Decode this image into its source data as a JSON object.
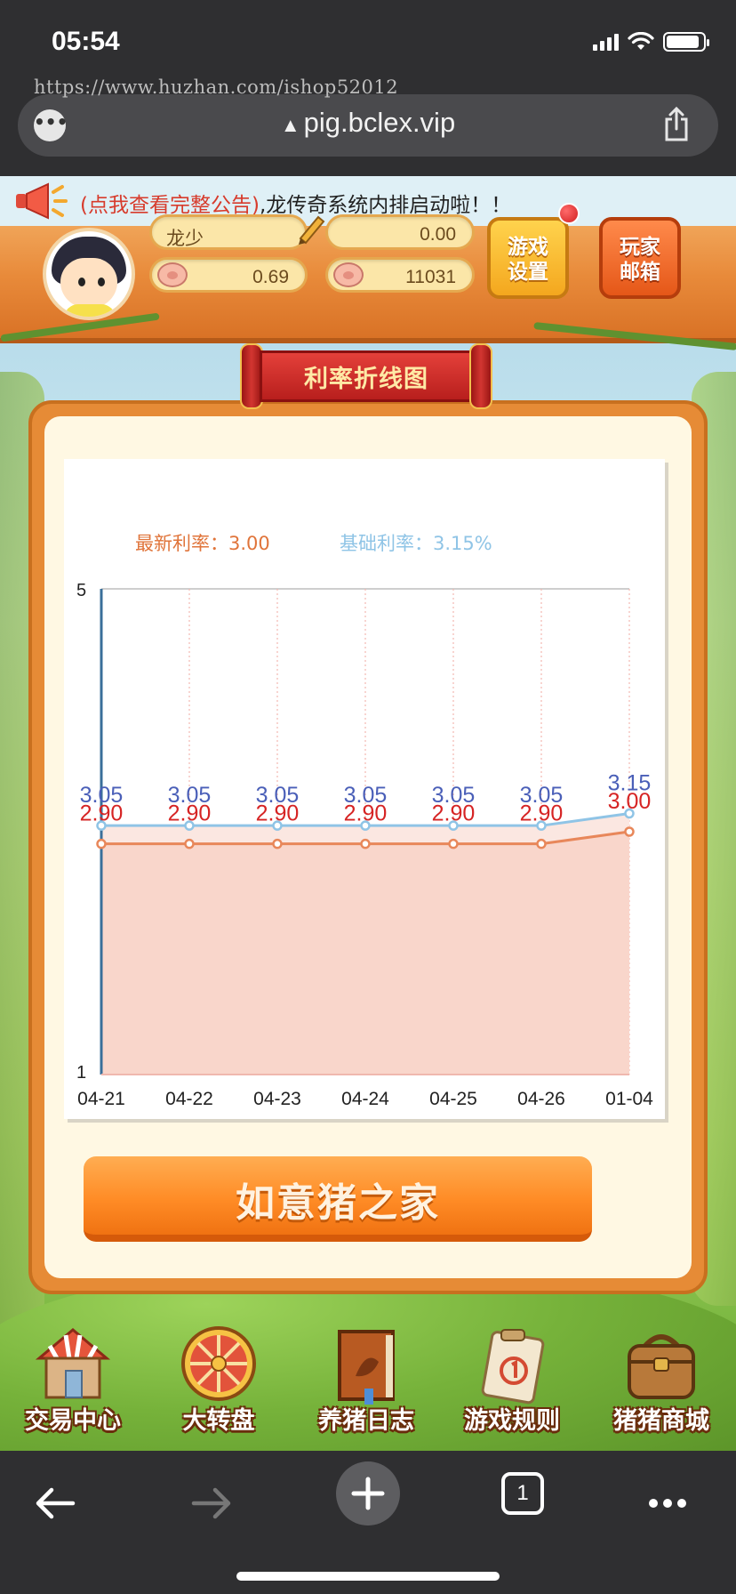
{
  "status_bar": {
    "time": "05:54"
  },
  "browser": {
    "watermark": "https://www.huzhan.com/ishop52012",
    "url": "pig.bclex.vip"
  },
  "notice": {
    "link": "(点我查看完整公告)",
    "text": ",龙传奇系统内排启动啦！！"
  },
  "user": {
    "name": "龙少",
    "balance": "0.00",
    "pig_small": "0.69",
    "pig_big": "11031"
  },
  "buttons": {
    "settings_line1": "游戏",
    "settings_line2": "设置",
    "mail_line1": "玩家",
    "mail_line2": "邮箱"
  },
  "panel": {
    "title": "利率折线图",
    "action": "如意猪之家"
  },
  "chart_data": {
    "type": "line",
    "legend": [
      {
        "label": "最新利率：3.00",
        "color": "#e0743a"
      },
      {
        "label": "基础利率：3.15%",
        "color": "#8fc4e6"
      }
    ],
    "categories": [
      "04-21",
      "04-22",
      "04-23",
      "04-24",
      "04-25",
      "04-26",
      "01-04"
    ],
    "ylim": [
      1,
      5
    ],
    "ytick_labels": [
      "5",
      "1"
    ],
    "series": [
      {
        "values": [
          3.05,
          3.05,
          3.05,
          3.05,
          3.05,
          3.05,
          3.15
        ],
        "labels": [
          "3.05",
          "3.05",
          "3.05",
          "3.05",
          "3.05",
          "3.05",
          "3.15"
        ],
        "color": "#8fc4e6",
        "label_color": "#4a5fb8"
      },
      {
        "values": [
          2.9,
          2.9,
          2.9,
          2.9,
          2.9,
          2.9,
          3.0
        ],
        "labels": [
          "2.90",
          "2.90",
          "2.90",
          "2.90",
          "2.90",
          "2.90",
          "3.00"
        ],
        "color": "#e8875a",
        "label_color": "#d62424",
        "fill": "#f9d6cb"
      }
    ],
    "grid": true,
    "legend_position": "top"
  },
  "nav": [
    {
      "label": "交易中心",
      "icon": "shop-icon"
    },
    {
      "label": "大转盘",
      "icon": "wheel-icon"
    },
    {
      "label": "养猪日志",
      "icon": "book-icon"
    },
    {
      "label": "游戏规则",
      "icon": "rules-icon"
    },
    {
      "label": "猪猪商城",
      "icon": "bag-icon"
    }
  ],
  "toolbar": {
    "tab_count": "1"
  }
}
